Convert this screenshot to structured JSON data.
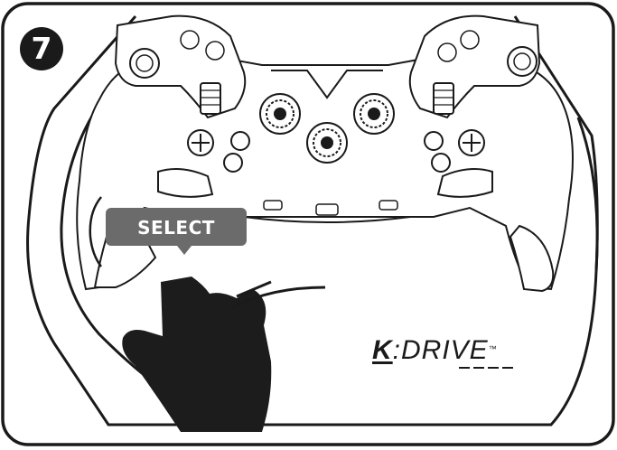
{
  "step": {
    "number": "7"
  },
  "button_label": "SELECT",
  "brand": {
    "k": "K",
    "rest": ":DRIVE",
    "tm": "™"
  },
  "colors": {
    "line": "#1a1a1a",
    "select_fill": "#6b6b6b",
    "hand": "#1c1c1c"
  }
}
